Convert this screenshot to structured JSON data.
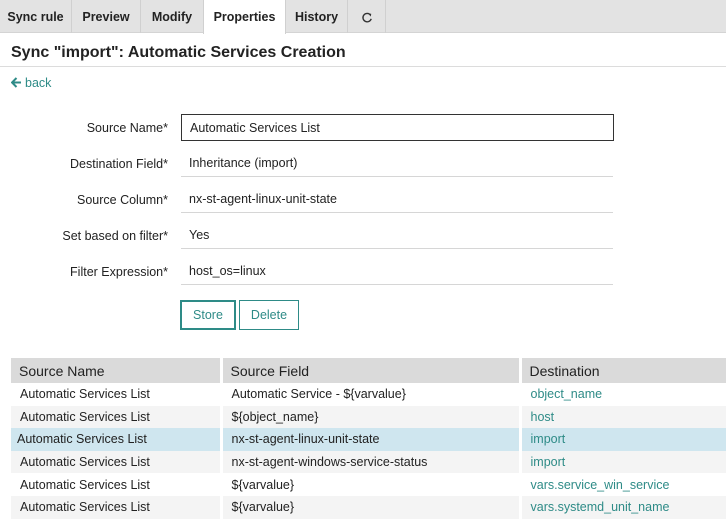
{
  "tabs": [
    {
      "label": "Sync rule"
    },
    {
      "label": "Preview"
    },
    {
      "label": "Modify"
    },
    {
      "label": "Properties",
      "active": true
    },
    {
      "label": "History"
    }
  ],
  "page_title": "Sync \"import\": Automatic Services Creation",
  "back_label": "back",
  "form": {
    "source_name": {
      "label": "Source Name*",
      "value": "Automatic Services List"
    },
    "destination_field": {
      "label": "Destination Field*",
      "value": "Inheritance (import)"
    },
    "source_column": {
      "label": "Source Column*",
      "value": "nx-st-agent-linux-unit-state"
    },
    "set_based_on_filter": {
      "label": "Set based on filter*",
      "value": "Yes"
    },
    "filter_expression": {
      "label": "Filter Expression*",
      "value": "host_os=linux"
    }
  },
  "buttons": {
    "store": "Store",
    "delete": "Delete"
  },
  "table": {
    "headers": [
      "Source Name",
      "Source Field",
      "Destination"
    ],
    "rows": [
      {
        "source_name": "Automatic Services List",
        "source_field": "Automatic Service - ${varvalue}",
        "destination": "object_name"
      },
      {
        "source_name": "Automatic Services List",
        "source_field": "${object_name}",
        "destination": "host"
      },
      {
        "source_name": "Automatic Services List",
        "source_field": "nx-st-agent-linux-unit-state",
        "destination": "import",
        "selected": true
      },
      {
        "source_name": "Automatic Services List",
        "source_field": "nx-st-agent-windows-service-status",
        "destination": "import"
      },
      {
        "source_name": "Automatic Services List",
        "source_field": "${varvalue}",
        "destination": "vars.service_win_service"
      },
      {
        "source_name": "Automatic Services List",
        "source_field": "${varvalue}",
        "destination": "vars.systemd_unit_name"
      }
    ]
  },
  "colors": {
    "accent": "#2e8b87",
    "selected_row": "#cfe6ef",
    "tabbar": "#e3e3e3"
  }
}
